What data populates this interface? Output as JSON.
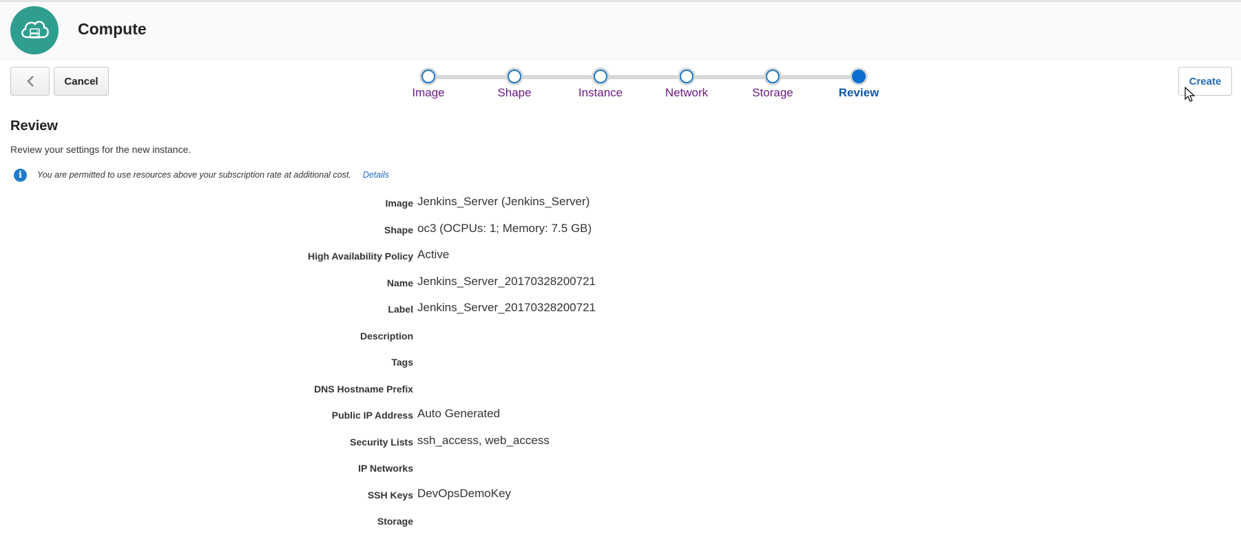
{
  "header": {
    "title": "Compute",
    "logo_icon": "cloud-server-icon"
  },
  "toolbar": {
    "back_icon": "chevron-left-icon",
    "cancel_label": "Cancel",
    "create_label": "Create"
  },
  "train": {
    "steps": [
      {
        "label": "Image",
        "state": "visited"
      },
      {
        "label": "Shape",
        "state": "visited"
      },
      {
        "label": "Instance",
        "state": "visited"
      },
      {
        "label": "Network",
        "state": "visited"
      },
      {
        "label": "Storage",
        "state": "visited"
      },
      {
        "label": "Review",
        "state": "current"
      }
    ]
  },
  "review": {
    "title": "Review",
    "description": "Review your settings for the new instance.",
    "info_text": "You are permitted to use resources above your subscription rate at additional cost.",
    "info_link": "Details",
    "fields": [
      {
        "label": "Image",
        "value": "Jenkins_Server (Jenkins_Server)"
      },
      {
        "label": "Shape",
        "value": "oc3 (OCPUs: 1; Memory: 7.5 GB)"
      },
      {
        "label": "High Availability Policy",
        "value": "Active"
      },
      {
        "label": "Name",
        "value": "Jenkins_Server_20170328200721"
      },
      {
        "label": "Label",
        "value": "Jenkins_Server_20170328200721"
      },
      {
        "label": "Description",
        "value": ""
      },
      {
        "label": "Tags",
        "value": ""
      },
      {
        "label": "DNS Hostname Prefix",
        "value": ""
      },
      {
        "label": "Public IP Address",
        "value": "Auto Generated"
      },
      {
        "label": "Security Lists",
        "value": "ssh_access, web_access"
      },
      {
        "label": "IP Networks",
        "value": ""
      },
      {
        "label": "SSH Keys",
        "value": "DevOpsDemoKey"
      },
      {
        "label": "Storage",
        "value": ""
      }
    ]
  },
  "colors": {
    "brand_teal": "#2f9e8f",
    "link_blue": "#1f6ab7",
    "visited_purple": "#6a1b83",
    "current_blue": "#0d58a6"
  }
}
